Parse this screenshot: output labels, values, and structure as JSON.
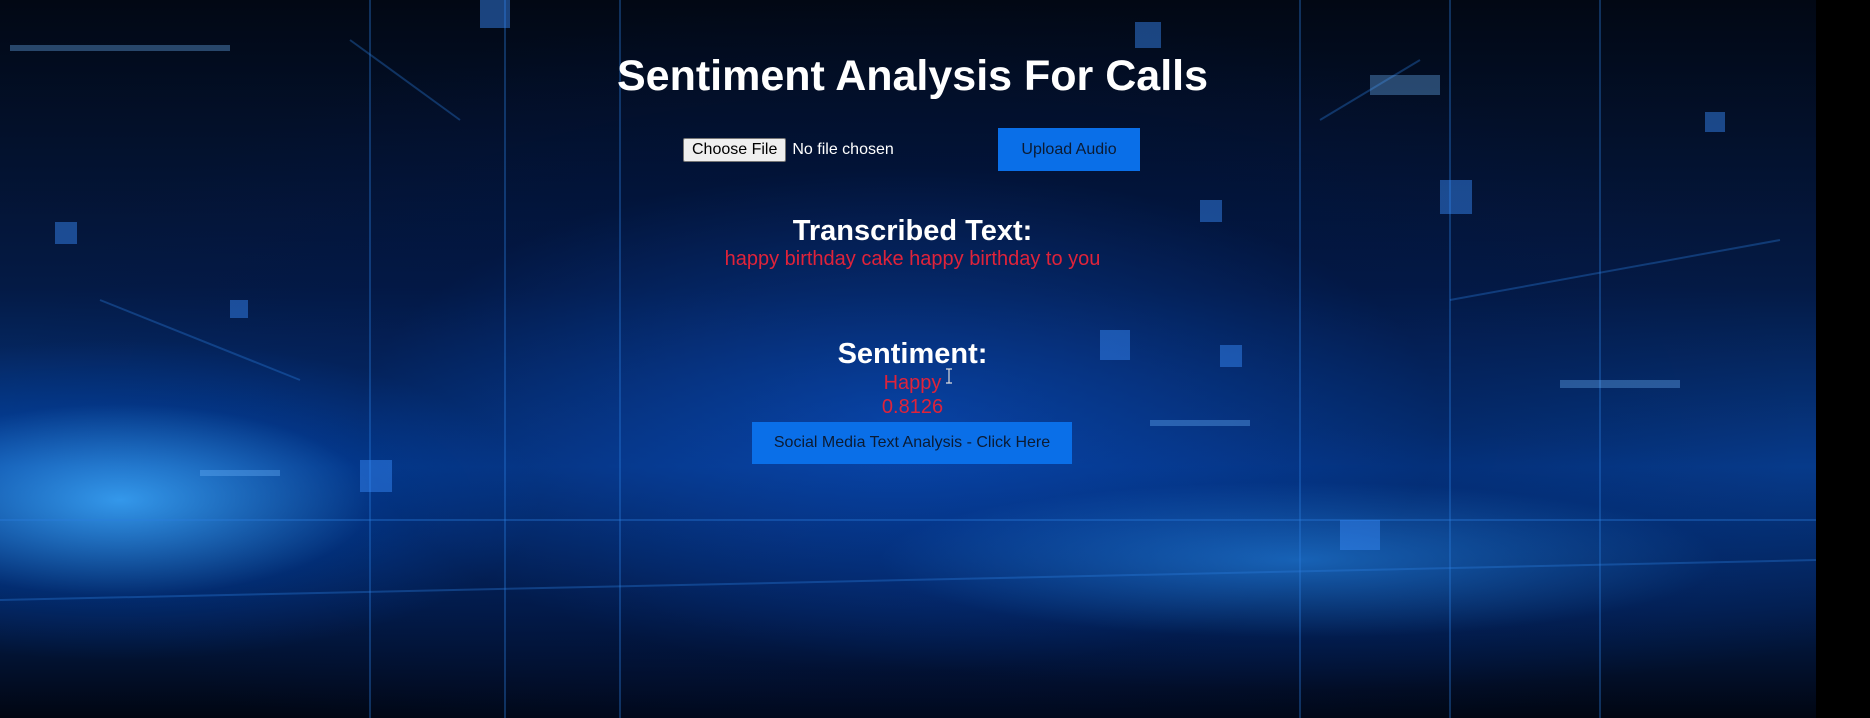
{
  "page": {
    "title": "Sentiment Analysis For Calls"
  },
  "upload": {
    "choose_file_label": "Choose File",
    "file_status": "No file chosen",
    "upload_button_label": "Upload Audio"
  },
  "transcription": {
    "heading": "Transcribed Text:",
    "text": "happy birthday cake happy birthday to you"
  },
  "sentiment": {
    "heading": "Sentiment:",
    "label": "Happy",
    "score": "0.8126"
  },
  "social": {
    "button_label": "Social Media Text Analysis - Click Here"
  },
  "colors": {
    "button_bg": "#0a6fe8",
    "result_text": "#e0233a",
    "heading_text": "#ffffff"
  },
  "icons": {
    "cursor": "text-cursor-icon"
  }
}
